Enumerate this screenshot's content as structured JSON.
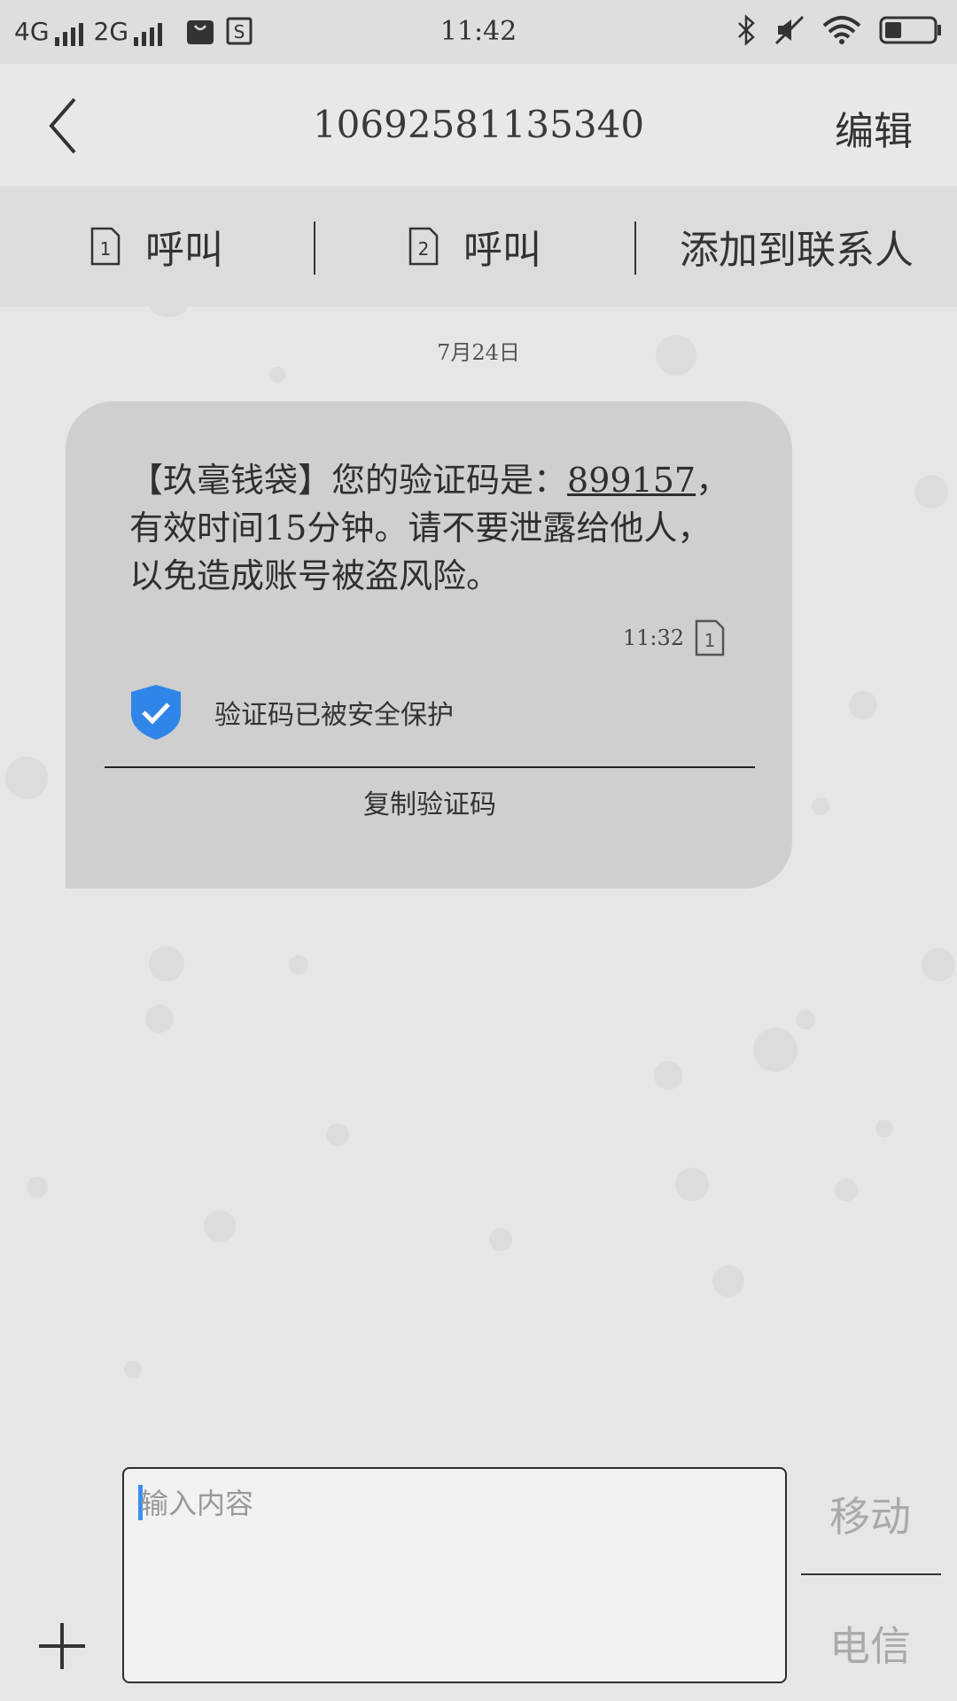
{
  "status_bar": {
    "network1": "4G",
    "network2": "2G",
    "time": "11:42"
  },
  "header": {
    "title": "10692581135340",
    "edit_label": "编辑"
  },
  "actions": {
    "call_sim1": "呼叫",
    "sim1_number": "1",
    "call_sim2": "呼叫",
    "sim2_number": "2",
    "add_contact": "添加到联系人"
  },
  "conversation": {
    "date": "7月24日",
    "message": {
      "text_prefix": "【玖毫钱袋】您的验证码是：",
      "code": "899157",
      "text_suffix": "，有效时间15分钟。请不要泄露给他人，以免造成账号被盗风险。",
      "time": "11:32",
      "sim_number": "1",
      "protected_label": "验证码已被安全保护",
      "copy_label": "复制验证码"
    }
  },
  "composer": {
    "placeholder": "输入内容",
    "sim1_label": "移动",
    "sim2_label": "电信"
  },
  "colors": {
    "accent": "#3a8ff0",
    "shield": "#2f86e8"
  }
}
